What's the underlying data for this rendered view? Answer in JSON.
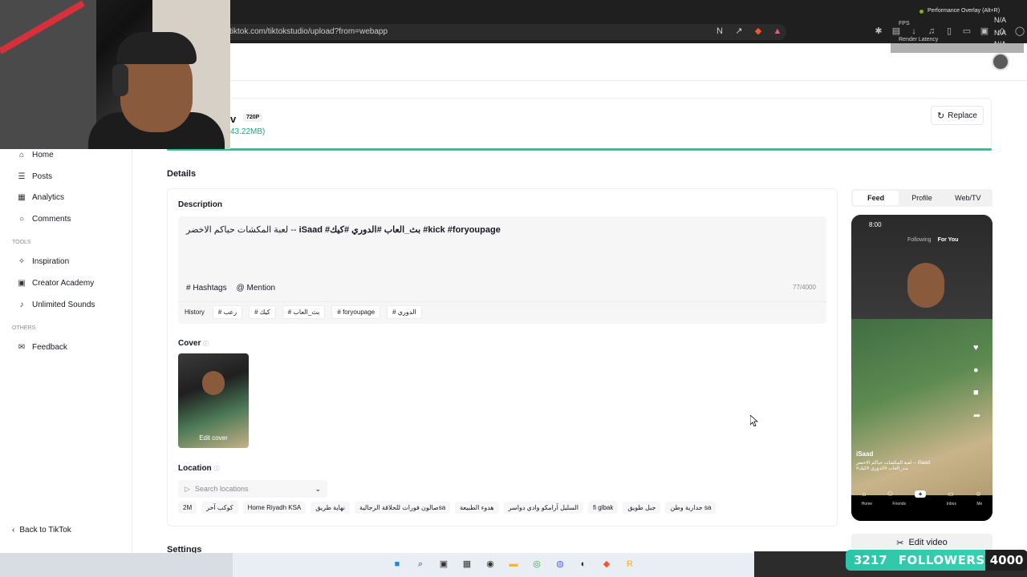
{
  "browser": {
    "url": "tiktok.com/tiktokstudio/upload?from=webapp",
    "overlay_title": "Performance Overlay (Alt+R)",
    "fps_label": "FPS",
    "fps_value": "N/A",
    "render_latency_label": "Render Latency",
    "render_latency_value": "N/A",
    "extra_value": "N/A"
  },
  "upload": {
    "file_name": "v",
    "resolution": "720P",
    "file_size": "43.22MB)",
    "replace_label": "Replace"
  },
  "sidebar": {
    "items": [
      {
        "label": "Home",
        "icon": "home-icon"
      },
      {
        "label": "Posts",
        "icon": "posts-icon"
      },
      {
        "label": "Analytics",
        "icon": "analytics-icon"
      },
      {
        "label": "Comments",
        "icon": "comments-icon"
      }
    ],
    "tools_label": "TOOLS",
    "tools": [
      {
        "label": "Inspiration",
        "icon": "lightbulb-icon"
      },
      {
        "label": "Creator Academy",
        "icon": "academy-icon"
      },
      {
        "label": "Unlimited Sounds",
        "icon": "music-icon"
      }
    ],
    "others_label": "OTHERS",
    "others": [
      {
        "label": "Feedback",
        "icon": "feedback-icon"
      }
    ],
    "back_label": "Back to TikTok"
  },
  "details": {
    "title": "Details",
    "description_label": "Description",
    "description_prefix": "لعبة المكشات حياكم الاخضر -- ",
    "description_tags": "iSaad #بث_العاب #الدوري #كيك #kick #foryoupage",
    "hashtags_label": "Hashtags",
    "mention_label": "Mention",
    "char_count": "77/4000",
    "history_label": "History",
    "history_chips": [
      "# رعب",
      "# كيك",
      "# بث_العاب",
      "# foryoupage",
      "# الدوري"
    ],
    "cover_label": "Cover",
    "edit_cover_label": "Edit cover",
    "location_label": "Location",
    "location_placeholder": "Search locations",
    "location_chips": [
      "2M",
      "كوكب آخر",
      "Home Riyadh KSA",
      "نهاية طريق",
      "صالون فورات للحلاقة الرجاليةsa",
      "هدوء الطبيعة",
      "السليل آرامكو وادي دواسر",
      "fi glbak",
      "جبل طويق",
      "جدارية وطن sa"
    ],
    "settings_label": "Settings"
  },
  "preview": {
    "tabs": [
      "Feed",
      "Profile",
      "Web/TV"
    ],
    "active_tab": "Feed",
    "phone_time": "8:00",
    "nav_following": "Following",
    "nav_for_you": "For You",
    "username": "iSaad",
    "caption": "لعبة المكشات حياكم الاخضر -- iSaad #بث_العاب #الدوري #كيك",
    "bottom_nav": [
      "Home",
      "Friends",
      "+",
      "Inbox",
      "Me"
    ],
    "edit_video_label": "Edit video"
  },
  "taskbar": {
    "left_text": "",
    "followers_count": "3217",
    "followers_label": "FOLLOWERS",
    "followers_goal": "4000"
  }
}
